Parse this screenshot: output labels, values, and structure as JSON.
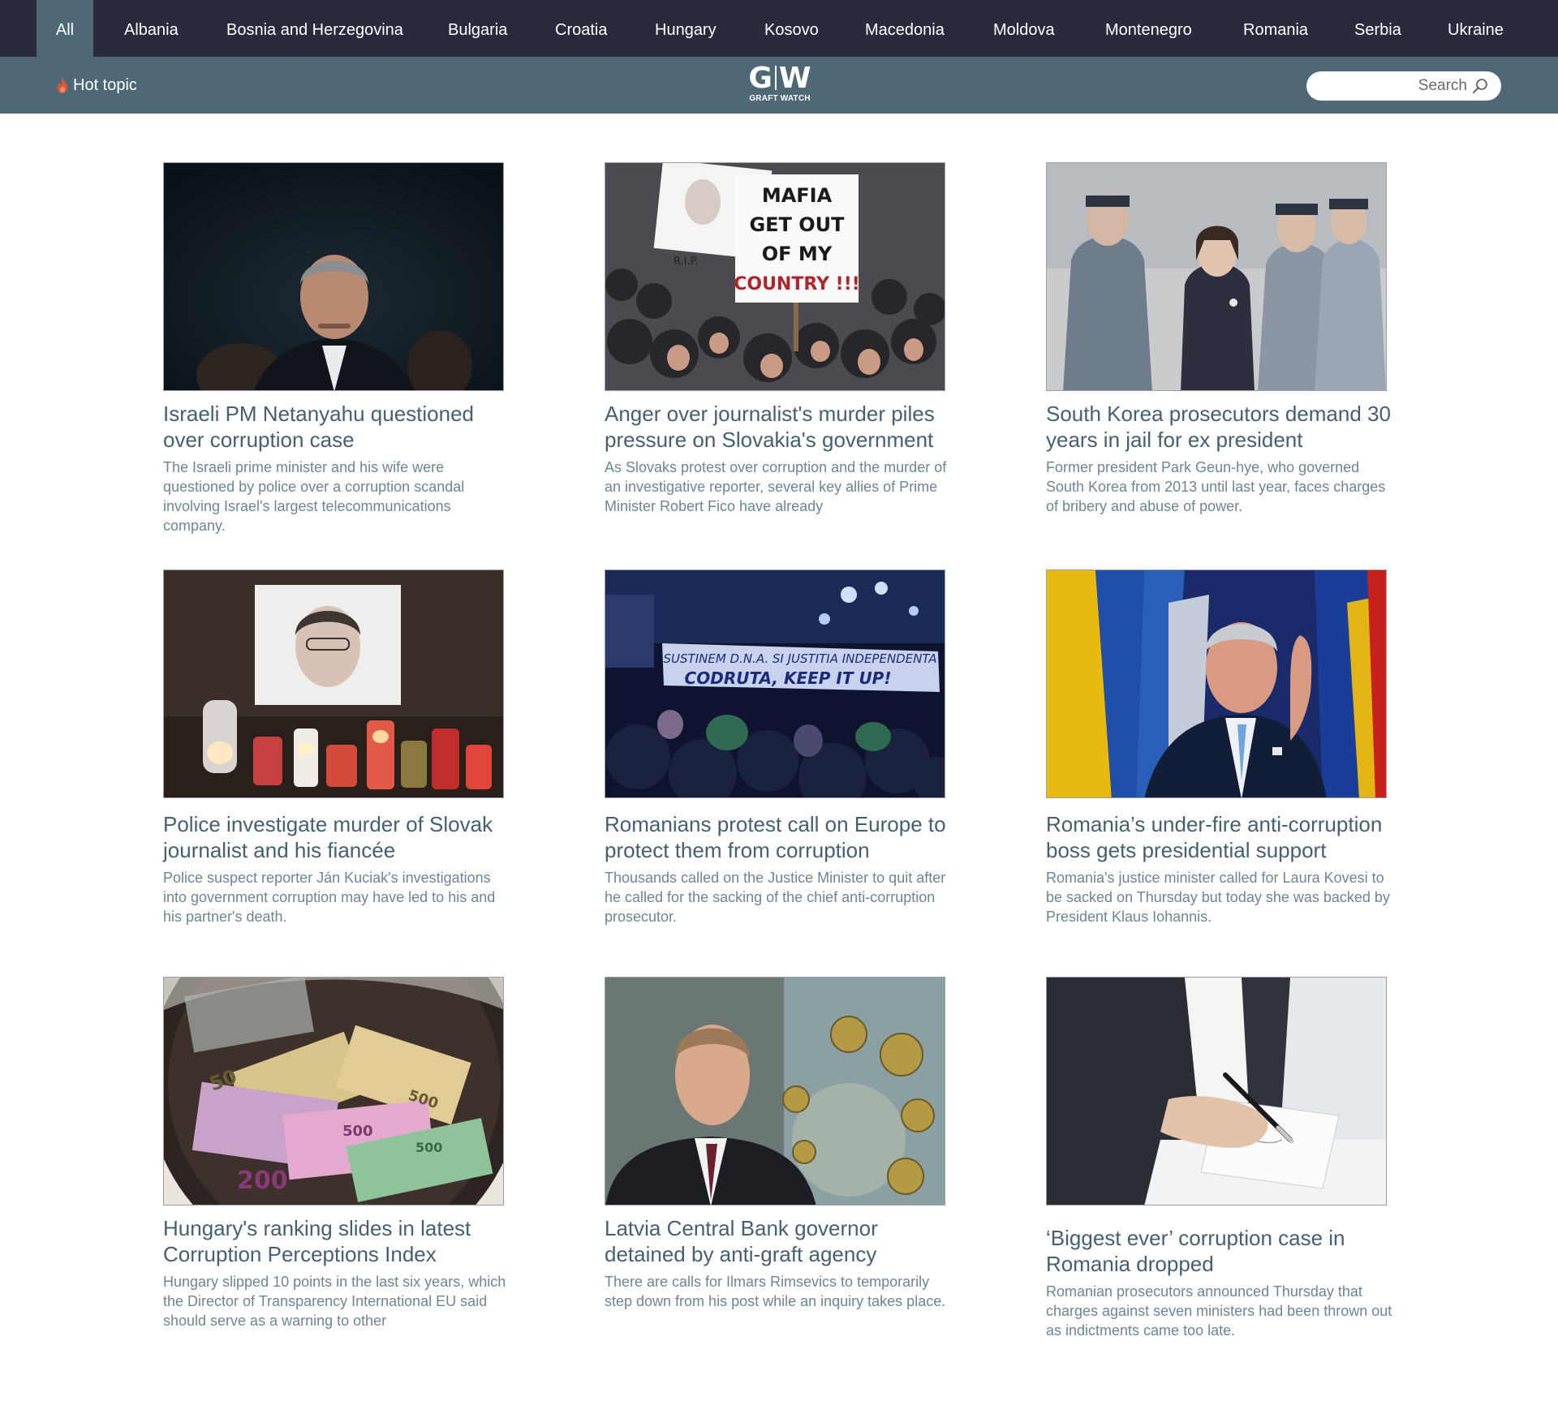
{
  "nav": {
    "items": [
      "All",
      "Albania",
      "Bosnia and Herzegovina",
      "Bulgaria",
      "Croatia",
      "Hungary",
      "Kosovo",
      "Macedonia",
      "Moldova",
      "Montenegro",
      "Romania",
      "Serbia",
      "Ukraine"
    ],
    "active": "All"
  },
  "subbar": {
    "hot_topic": "Hot topic",
    "logo_mark_left": "G",
    "logo_mark_right": "W",
    "logo_sub": "GRAFT WATCH",
    "search_placeholder": "Search"
  },
  "icons": {
    "hot": "flame-icon",
    "search": "magnifier-icon"
  },
  "colors": {
    "nav_bg": "#282b3d",
    "subbar_bg": "#4e6876",
    "title": "#46606f",
    "desc": "#6e8593",
    "hot_icon": "#e0553c"
  },
  "articles": [
    {
      "title": "Israeli PM Netanyahu questioned over corruption case",
      "desc": "The Israeli prime minister and his wife were questioned by police over a corruption scandal involving Israel's largest telecommunications company.",
      "image": "man in suit in front of dark background"
    },
    {
      "title": "Anger over journalist's murder piles pressure on Slovakia's government",
      "desc": "As Slovaks protest over corruption and the murder of an investigative reporter, several key allies of Prime Minister Robert Fico have already",
      "image": "protest crowd with sign",
      "sign_lines": [
        "MAFIA",
        "GET OUT",
        "OF MY",
        "COUNTRY !!!"
      ],
      "photo_caption": "R.I.P."
    },
    {
      "title": "South Korea prosecutors demand 30 years in jail for ex president",
      "desc": "Former president Park Geun-hye, who governed South Korea from 2013 until last year, faces charges of bribery and abuse of power.",
      "image": "woman escorted by guards"
    },
    {
      "title": "Police investigate murder of Slovak journalist and his fiancée",
      "desc": "Police suspect reporter Ján Kuciak's investigations into government corruption may have led to his and his partner's death.",
      "image": "memorial candles under a portrait"
    },
    {
      "title": "Romanians protest call on Europe to protect them from corruption",
      "desc": "Thousands called on the Justice Minister to quit after he called for the sacking of the chief anti-corruption prosecutor.",
      "image": "night protest with banner",
      "banner_lines": [
        "SUSTINEM D.N.A. SI JUSTITIA INDEPENDENTA",
        "CODRUTA, KEEP IT UP!"
      ]
    },
    {
      "title": "Romania’s under-fire anti-corruption boss gets presidential support",
      "desc": "Romania's justice minister called for Laura Kovesi to be sacked on Thursday but today she was backed by President Klaus Iohannis.",
      "image": "man waving in front of flags"
    },
    {
      "title": "Hungary's ranking slides in latest Corruption Perceptions Index",
      "desc": "Hungary slipped 10 points in the last six years, which the Director of Transparency International EU said should serve as a warning to other",
      "image": "euro banknotes in a washing machine",
      "note_labels": [
        "50",
        "500",
        "500",
        "200",
        "500"
      ]
    },
    {
      "title": "Latvia Central Bank governor detained by anti-graft agency",
      "desc": "There are calls for Ilmars Rimsevics to temporarily step down from his post while an inquiry takes place.",
      "image": "man in suit in front of coin display"
    },
    {
      "title": "‘Biggest ever’ corruption case in Romania dropped",
      "desc": "Romanian prosecutors announced Thursday that charges against seven ministers had been thrown out as indictments came too late.",
      "image": "hand signing a document"
    }
  ]
}
